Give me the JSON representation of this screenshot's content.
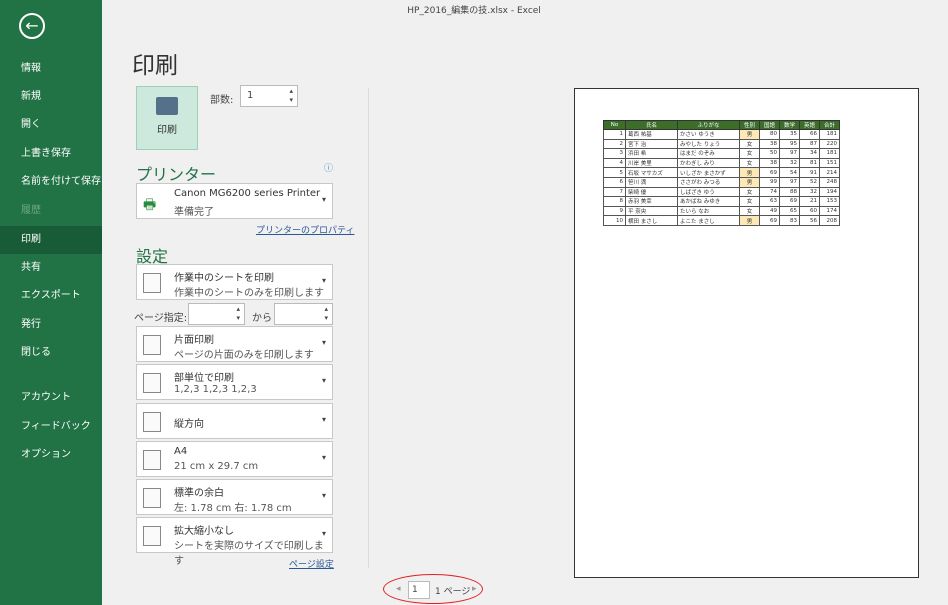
{
  "window": {
    "title": "HP_2016_編集の技.xlsx  -  Excel"
  },
  "sidebar": {
    "items": [
      {
        "label": "情報"
      },
      {
        "label": "新規"
      },
      {
        "label": "開く"
      },
      {
        "label": "上書き保存"
      },
      {
        "label": "名前を付けて保存"
      },
      {
        "label": "履歴",
        "disabled": true
      },
      {
        "label": "印刷",
        "active": true
      },
      {
        "label": "共有"
      },
      {
        "label": "エクスポート"
      },
      {
        "label": "発行"
      },
      {
        "label": "閉じる"
      },
      {
        "label": "アカウント"
      },
      {
        "label": "フィードバック"
      },
      {
        "label": "オプション"
      }
    ]
  },
  "print": {
    "title": "印刷",
    "button": "印刷",
    "copies_label": "部数:",
    "copies": "1"
  },
  "printer": {
    "heading": "プリンター",
    "name": "Canon MG6200 series Printer",
    "status": "準備完了",
    "properties_link": "プリンターのプロパティ"
  },
  "settings": {
    "heading": "設定",
    "what": {
      "t1": "作業中のシートを印刷",
      "t2": "作業中のシートのみを印刷します"
    },
    "pages_label": "ページ指定:",
    "pages_to": "から",
    "sides": {
      "t1": "片面印刷",
      "t2": "ページの片面のみを印刷します"
    },
    "collate": {
      "t1": "部単位で印刷",
      "t2": "1,2,3    1,2,3    1,2,3"
    },
    "orientation": {
      "t1": "縦方向"
    },
    "paper": {
      "t1": "A4",
      "t2": "21 cm x 29.7 cm"
    },
    "margins": {
      "t1": "標準の余白",
      "t2": "左:  1.78 cm    右:  1.78 cm"
    },
    "scaling": {
      "t1": "拡大縮小なし",
      "t2": "シートを実際のサイズで印刷します"
    },
    "page_setup_link": "ページ設定"
  },
  "preview": {
    "headers": [
      "No",
      "氏名",
      "ふりがな",
      "性別",
      "国語",
      "数学",
      "英語",
      "合計"
    ],
    "rows": [
      [
        "1",
        "葛西 祐基",
        "かさい ゆうき",
        "男",
        "80",
        "35",
        "66",
        "181"
      ],
      [
        "2",
        "宮下 治",
        "みやした りょう",
        "女",
        "38",
        "95",
        "87",
        "220"
      ],
      [
        "3",
        "浜田 希",
        "はまだ のぞみ",
        "女",
        "50",
        "97",
        "34",
        "181"
      ],
      [
        "4",
        "川岸 美里",
        "かわぎし みり",
        "女",
        "38",
        "32",
        "81",
        "151"
      ],
      [
        "5",
        "石坂 マサカズ",
        "いしざか まさかず",
        "男",
        "69",
        "54",
        "91",
        "214"
      ],
      [
        "6",
        "笹川 満",
        "ささがわ みつる",
        "男",
        "99",
        "97",
        "52",
        "248"
      ],
      [
        "7",
        "柴崎 優",
        "しばざき ゆう",
        "女",
        "74",
        "88",
        "32",
        "194"
      ],
      [
        "8",
        "赤羽 美幸",
        "あかばね みゆき",
        "女",
        "63",
        "69",
        "21",
        "153"
      ],
      [
        "9",
        "平 奈央",
        "たいら なお",
        "女",
        "49",
        "65",
        "60",
        "174"
      ],
      [
        "10",
        "横田 まさし",
        "よこた まさし",
        "男",
        "69",
        "83",
        "56",
        "208"
      ]
    ]
  },
  "pager": {
    "current": "1",
    "total": "1 ページ"
  }
}
